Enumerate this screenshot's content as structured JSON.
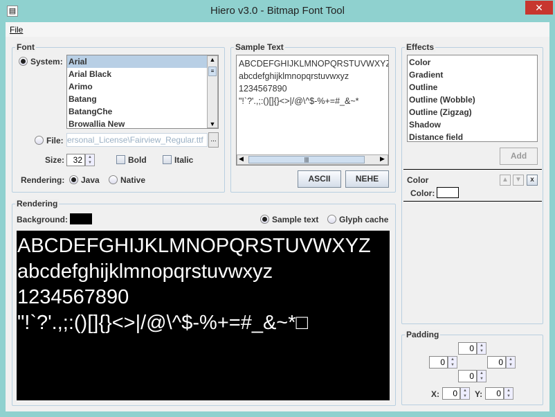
{
  "window": {
    "title": "Hiero v3.0 - Bitmap Font Tool",
    "close_label": "✕"
  },
  "menu": {
    "file": "File"
  },
  "font": {
    "group_label": "Font",
    "system_label": "System:",
    "system_selected": true,
    "fonts": [
      "Arial",
      "Arial Black",
      "Arimo",
      "Batang",
      "BatangChe",
      "Browallia New"
    ],
    "selected_font": "Arial",
    "file_label": "File:",
    "file_value": "ersonal_License\\Fairview_Regular.ttf",
    "browse_label": "...",
    "size_label": "Size:",
    "size_value": "32",
    "bold_label": "Bold",
    "bold_checked": false,
    "italic_label": "Italic",
    "italic_checked": false,
    "rendering_label": "Rendering:",
    "java_label": "Java",
    "native_label": "Native",
    "rendering_selected": "Java"
  },
  "sample": {
    "group_label": "Sample Text",
    "lines": [
      "ABCDEFGHIJKLMNOPQRSTUVWXYZ",
      "abcdefghijklmnopqrstuvwxyz",
      "1234567890",
      "\"!`?'.,;:()[]{}<>|/@\\^$-%+=#_&~*"
    ],
    "ascii_label": "ASCII",
    "nehe_label": "NEHE"
  },
  "effects": {
    "group_label": "Effects",
    "items": [
      "Color",
      "Gradient",
      "Outline",
      "Outline (Wobble)",
      "Outline (Zigzag)",
      "Shadow",
      "Distance field"
    ],
    "add_label": "Add",
    "active": {
      "title": "Color",
      "color_label": "Color:",
      "color_value": "#ffffff",
      "remove_label": "x"
    }
  },
  "rendering": {
    "group_label": "Rendering",
    "background_label": "Background:",
    "background_color": "#000000",
    "sample_text_label": "Sample text",
    "glyph_cache_label": "Glyph cache",
    "mode_selected": "Sample text",
    "preview_lines": [
      "ABCDEFGHIJKLMNOPQRSTUVWXYZ",
      "abcdefghijklmnopqrstuvwxyz",
      "1234567890",
      "\"!`?'.,;:()[]{}<>|/@\\^$-%+=#_&~*□"
    ]
  },
  "padding": {
    "group_label": "Padding",
    "top": "0",
    "left": "0",
    "right": "0",
    "bottom": "0",
    "x_label": "X:",
    "x": "0",
    "y_label": "Y:",
    "y": "0"
  }
}
